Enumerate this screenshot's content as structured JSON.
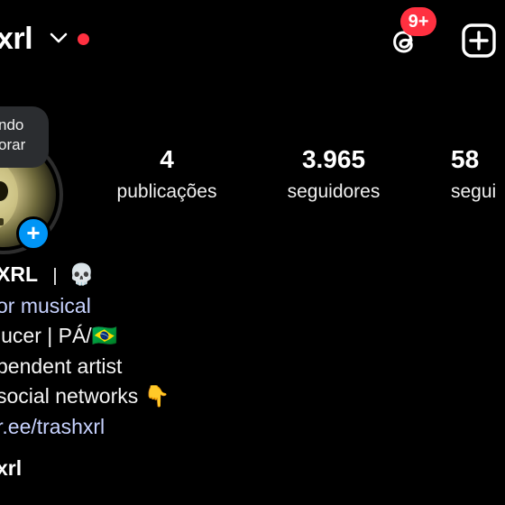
{
  "header": {
    "username": "xrl",
    "notification_badge": "9+",
    "accent_red": "#ff3040"
  },
  "note": {
    "line1": "ndo",
    "line2": "orar"
  },
  "profile": {
    "add_story_symbol": "+",
    "stats": {
      "posts": {
        "value": "4",
        "label": "publicações"
      },
      "followers": {
        "value": "3.965",
        "label": "seguidores"
      },
      "following": {
        "value": "58",
        "label": "segui"
      }
    }
  },
  "bio": {
    "name": "XRL",
    "name_separator": "|",
    "name_emoji": "💀",
    "category": "or musical",
    "line1_text": "lucer | PÁ/",
    "line1_flag": "🇧🇷",
    "line2": "pendent artist",
    "line3_text": "social networks",
    "line3_emoji": "👇",
    "link": "r.ee/trashxrl"
  },
  "footer": {
    "name": "xrl"
  },
  "icons": {
    "threads": "threads-icon",
    "add": "add-square-icon",
    "chevron": "chevron-down-icon"
  }
}
